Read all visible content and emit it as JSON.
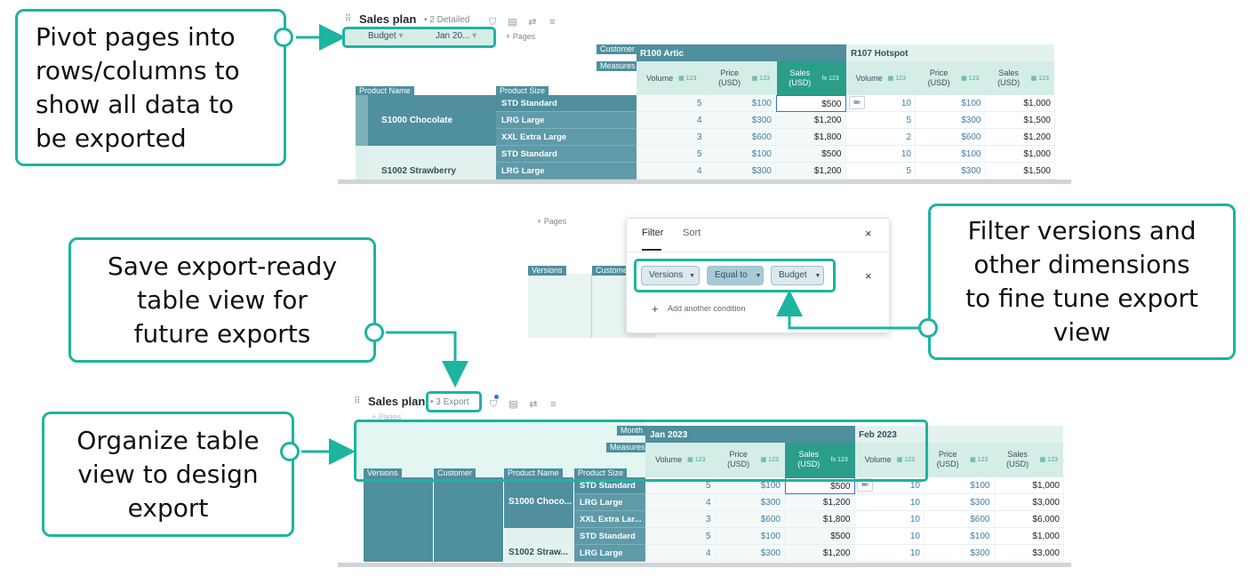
{
  "callouts": {
    "pivot": [
      "Pivot pages into",
      "rows/columns to",
      "show all data to",
      "be exported"
    ],
    "save": [
      "Save export-ready",
      "table view for",
      "future exports"
    ],
    "filter": [
      "Filter versions and",
      "other dimensions",
      "to fine tune export",
      "view"
    ],
    "organize": [
      "Organize table",
      "view to design",
      "export"
    ]
  },
  "top_grid": {
    "title": "Sales plan",
    "view": "2 Detailed",
    "pages": [
      "Budget",
      "Jan 20..."
    ],
    "add_pages": "+ Pages",
    "row_dims": [
      "Product Name",
      "Product Size"
    ],
    "col_dims": [
      "Customer",
      "Measures"
    ],
    "customers": [
      "R100 Artic",
      "R107 Hotspot"
    ],
    "measures": [
      "Volume",
      "Price (USD)",
      "Sales (USD)"
    ],
    "icon_code": "123",
    "fx": "fx",
    "products": [
      "S1000 Chocolate",
      "S1002 Strawberry"
    ],
    "rows": [
      {
        "size": "STD Standard",
        "v": [
          "5",
          "$100",
          "$500",
          "10",
          "$100",
          "$1,000"
        ]
      },
      {
        "size": "LRG Large",
        "v": [
          "4",
          "$300",
          "$1,200",
          "5",
          "$300",
          "$1,500"
        ]
      },
      {
        "size": "XXL Extra Large",
        "v": [
          "3",
          "$600",
          "$1,800",
          "2",
          "$600",
          "$1,200"
        ]
      },
      {
        "size": "STD Standard",
        "v": [
          "5",
          "$100",
          "$500",
          "10",
          "$100",
          "$1,000"
        ]
      },
      {
        "size": "LRG Large",
        "v": [
          "4",
          "$300",
          "$1,200",
          "5",
          "$300",
          "$1,500"
        ]
      }
    ]
  },
  "filter_popup": {
    "tabs": [
      "Filter",
      "Sort"
    ],
    "field": "Versions",
    "operator": "Equal to",
    "value": "Budget",
    "add": "Add another condition",
    "add_pages": "+ Pages",
    "bg_dims": [
      "Versions",
      "Customer"
    ]
  },
  "bottom_grid": {
    "title": "Sales plan",
    "view": "3 Export",
    "add_pages": "+ Pages",
    "row_dims": [
      "Versions",
      "Customer",
      "Product Name",
      "Product Size"
    ],
    "col_dims": [
      "Month",
      "Measures"
    ],
    "months": [
      "Jan 2023",
      "Feb 2023"
    ],
    "measures": [
      "Volume",
      "Price (USD)",
      "Sales (USD)"
    ],
    "products": [
      "S1000 Choco...",
      "S1002 Straw..."
    ],
    "rows": [
      {
        "size": "STD Standard",
        "v": [
          "5",
          "$100",
          "$500",
          "10",
          "$100",
          "$1,000"
        ]
      },
      {
        "size": "LRG Large",
        "v": [
          "4",
          "$300",
          "$1,200",
          "10",
          "$300",
          "$3,000"
        ]
      },
      {
        "size": "XXL Extra Lar...",
        "v": [
          "3",
          "$600",
          "$1,800",
          "10",
          "$600",
          "$6,000"
        ]
      },
      {
        "size": "STD Standard",
        "v": [
          "5",
          "$100",
          "$500",
          "10",
          "$100",
          "$1,000"
        ]
      },
      {
        "size": "LRG Large",
        "v": [
          "4",
          "$300",
          "$1,200",
          "10",
          "$300",
          "$3,000"
        ]
      }
    ]
  },
  "colors": {
    "accent": "#1db4a0",
    "header_teal": "#4f8f9e",
    "measure_bg": "#d5ede7",
    "selected_col": "#2b9e8a"
  }
}
